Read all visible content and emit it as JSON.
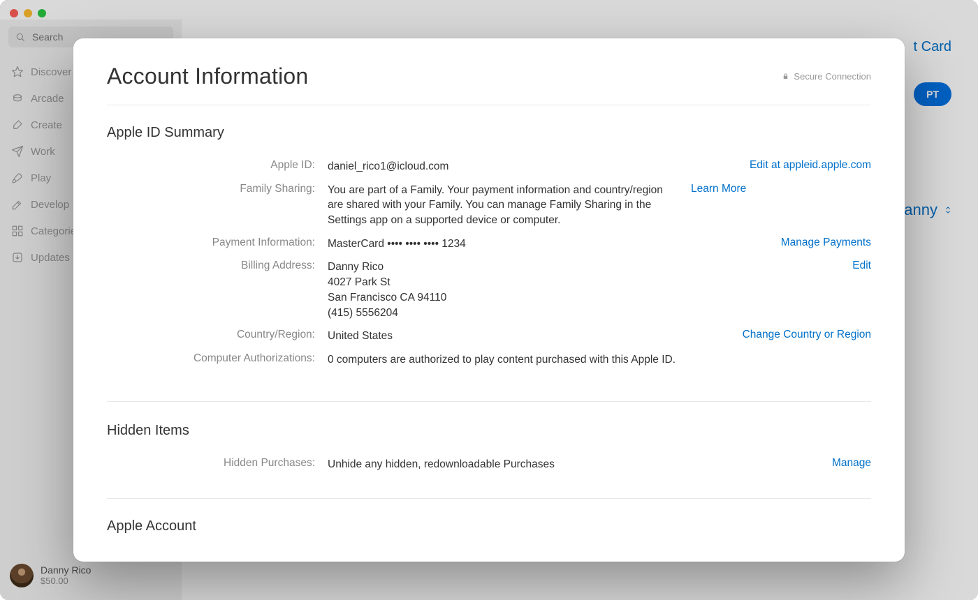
{
  "sidebar": {
    "search_placeholder": "Search",
    "items": [
      {
        "label": "Discover"
      },
      {
        "label": "Arcade"
      },
      {
        "label": "Create"
      },
      {
        "label": "Work"
      },
      {
        "label": "Play"
      },
      {
        "label": "Develop"
      },
      {
        "label": "Categories"
      },
      {
        "label": "Updates"
      }
    ],
    "user_name": "Danny Rico",
    "user_balance": "$50.00"
  },
  "background": {
    "header_link": "t Card",
    "button": "PT",
    "user_picker": "anny"
  },
  "sheet": {
    "title": "Account Information",
    "secure": "Secure Connection",
    "sections": {
      "summary": {
        "title": "Apple ID Summary",
        "apple_id": {
          "label": "Apple ID:",
          "value": "daniel_rico1@icloud.com",
          "action": "Edit at appleid.apple.com"
        },
        "family": {
          "label": "Family Sharing:",
          "value": "You are part of a Family. Your payment information and country/region are shared with your Family. You can manage Family Sharing in the Settings app on a supported device or computer.",
          "action": "Learn More"
        },
        "payment": {
          "label": "Payment Information:",
          "value": "MasterCard •••• •••• •••• 1234",
          "action": "Manage Payments"
        },
        "billing": {
          "label": "Billing Address:",
          "lines": [
            "Danny Rico",
            "4027 Park St",
            "San Francisco CA 94110",
            "(415) 5556204"
          ],
          "action": "Edit"
        },
        "country": {
          "label": "Country/Region:",
          "value": "United States",
          "action": "Change Country or Region"
        },
        "auth": {
          "label": "Computer Authorizations:",
          "value": "0 computers are authorized to play content purchased with this Apple ID."
        }
      },
      "hidden": {
        "title": "Hidden Items",
        "purchases": {
          "label": "Hidden Purchases:",
          "value": "Unhide any hidden, redownloadable Purchases",
          "action": "Manage"
        }
      },
      "truncated": {
        "title": "Apple Account"
      }
    }
  }
}
